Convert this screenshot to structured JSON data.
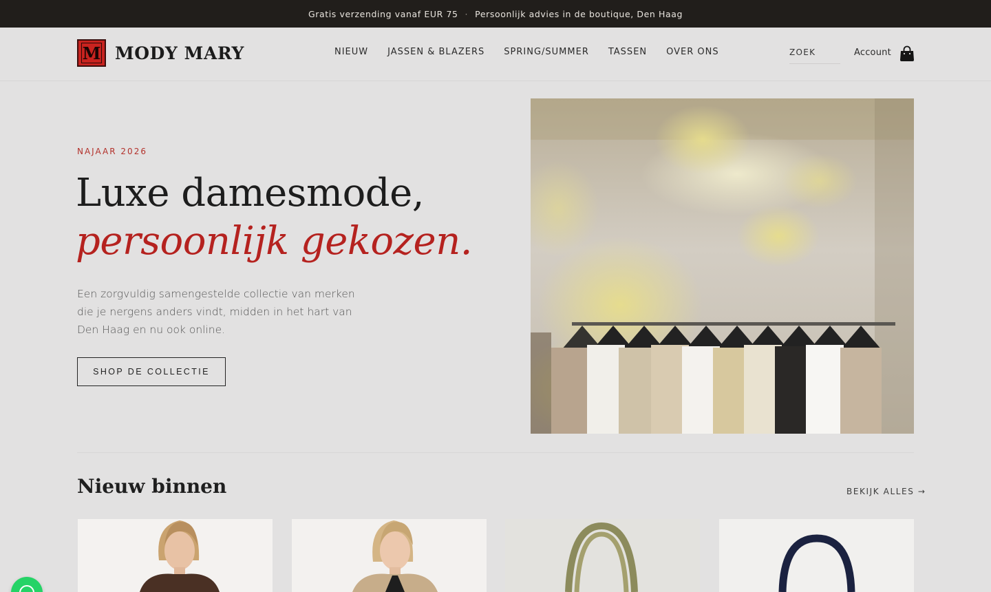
{
  "topbar": {
    "shipping_text": "Gratis verzending vanaf EUR 75",
    "separator": "·",
    "advice_text": "Persoonlijk advies in de boutique, Den Haag"
  },
  "header": {
    "logo_text": "MODY MARY",
    "logo_mark_letter": "M",
    "nav": [
      "NIEUW",
      "JASSEN & BLAZERS",
      "SPRING/SUMMER",
      "TASSEN",
      "OVER ONS"
    ],
    "search_placeholder": "ZOEK",
    "account_label": "Account",
    "bag_icon": "shopping-bag-icon"
  },
  "hero": {
    "eyebrow": "NAJAAR 2026",
    "headline_line1": "Luxe damesmode,",
    "headline_line2": "persoonlijk gekozen.",
    "lead": "Een zorgvuldig samengestelde collectie van merken die je nergens anders vindt, midden in het hart van Den Haag en nu ook online.",
    "cta_label": "SHOP DE COLLECTIE"
  },
  "new_in": {
    "title": "Nieuw binnen",
    "see_all": "BEKIJK ALLES →"
  },
  "colors": {
    "accent": "#b5221f",
    "topbar_bg": "#211e1b",
    "page_bg": "#e2e1e1",
    "whatsapp": "#25d366"
  },
  "whatsapp_icon": "whatsapp-icon"
}
